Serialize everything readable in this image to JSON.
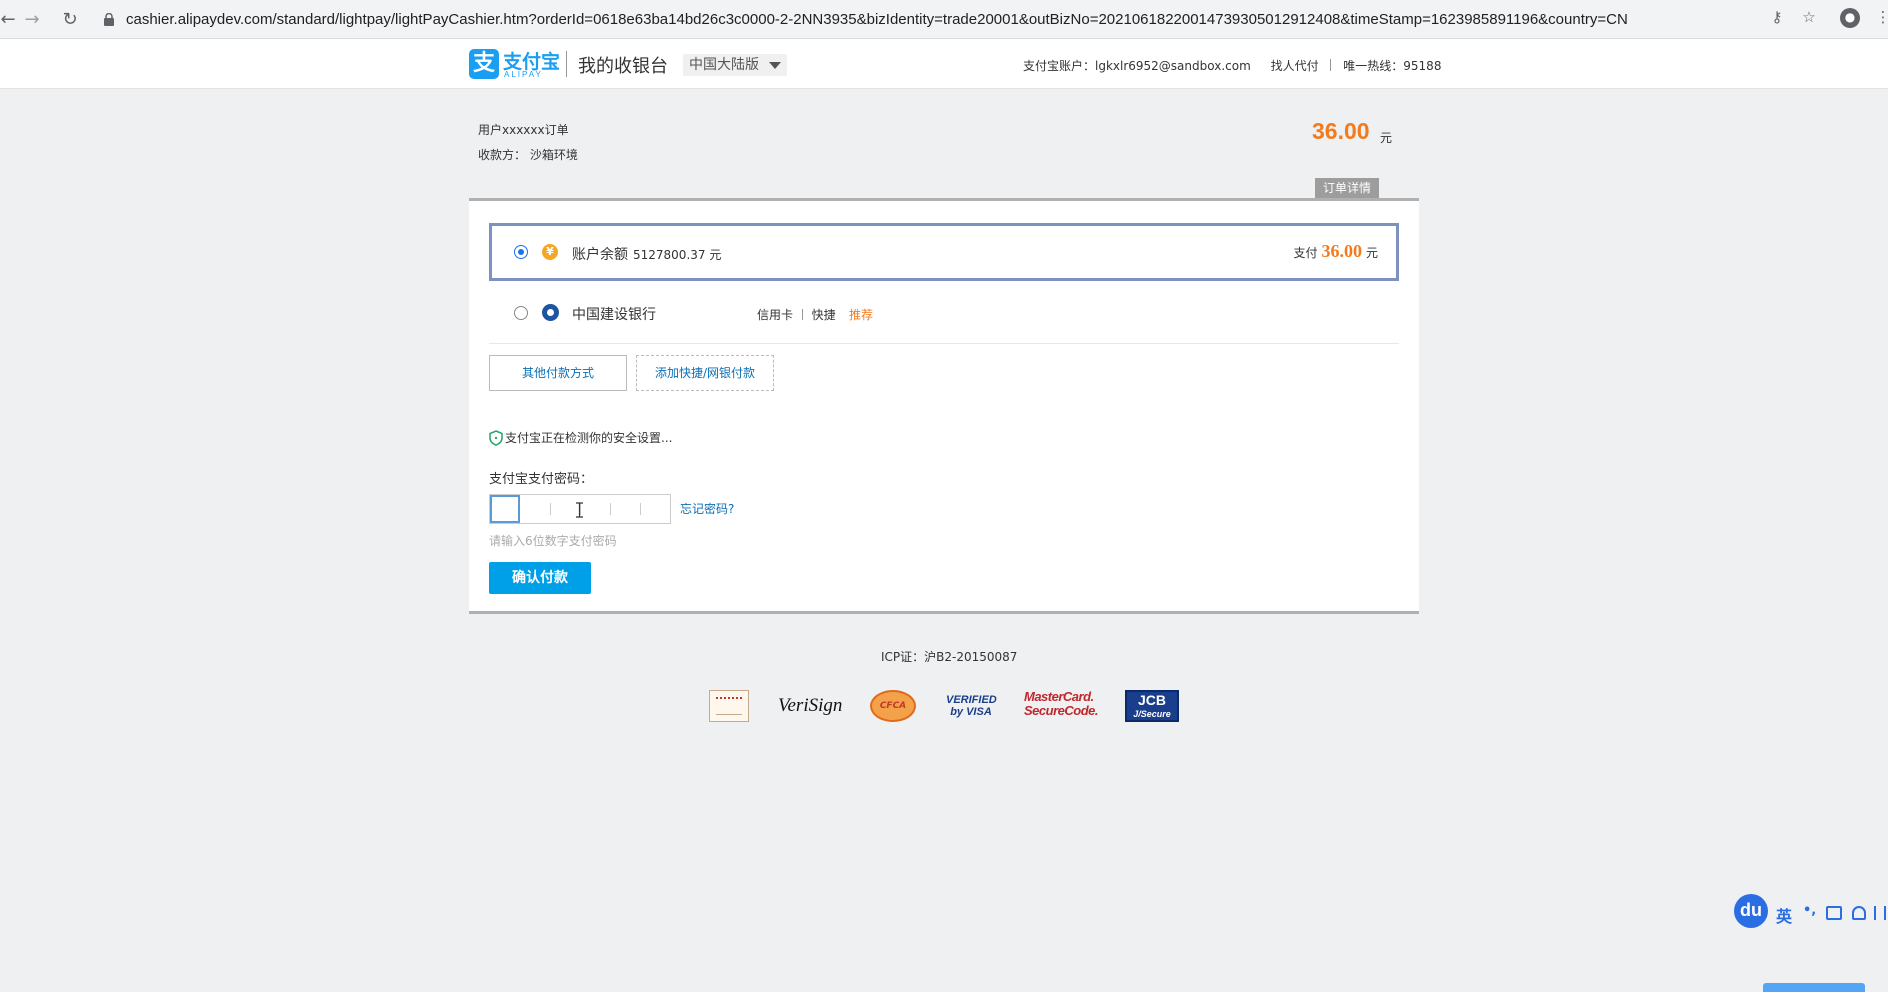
{
  "browser": {
    "url": "cashier.alipaydev.com/standard/lightpay/lightPayCashier.htm?orderId=0618e63ba14bd26c3c0000-2-2NN3935&bizIdentity=trade20001&outBizNo=20210618220014739305012912408&timeStamp=1623985891196&country=CN"
  },
  "header": {
    "logo_glyph": "支",
    "logo_text": "支付宝",
    "logo_sub": "ALIPAY",
    "title": "我的收银台",
    "region": "中国大陆版",
    "account_label": "支付宝账户：lgkxlr6952@sandbox.com",
    "proxy_pay": "找人代付",
    "hotline": "唯一热线：95188"
  },
  "order": {
    "title": "用户xxxxxx订单",
    "payee": "收款方： 沙箱环境",
    "amount": "36.00",
    "unit": "元",
    "detail_tab": "订单详情"
  },
  "payment": {
    "balance_icon": "¥",
    "balance_label": "账户余额",
    "balance_value": "5127800.37 元",
    "pay_prefix": "支付",
    "pay_amount": "36.00",
    "pay_unit": "元",
    "bank_name": "中国建设银行",
    "bank_type": "信用卡",
    "bank_mode": "快捷",
    "bank_tag": "推荐",
    "other_methods": "其他付款方式",
    "add_method": "添加快捷/网银付款"
  },
  "security": {
    "checking": "支付宝正在检测你的安全设置..."
  },
  "password": {
    "label": "支付宝支付密码：",
    "forgot": "忘记密码?",
    "hint": "请输入6位数字支付密码",
    "confirm": "确认付款"
  },
  "footer": {
    "icp": "ICP证：沪B2-20150087",
    "verisign": "VeriSign",
    "cfca": "CFCA",
    "visa_line1": "VERIFIED",
    "visa_line2": "by VISA",
    "mc_line1": "MasterCard.",
    "mc_line2": "SecureCode.",
    "jcb_line1": "JCB",
    "jcb_line2": "J/Secure"
  },
  "ime": {
    "logo": "du",
    "lang": "英",
    "punct": "•,"
  },
  "colors": {
    "accent_orange": "#f37b1d",
    "alipay_blue": "#1a9ef2",
    "confirm_blue": "#00a0e9",
    "link_blue": "#0a70b5"
  }
}
